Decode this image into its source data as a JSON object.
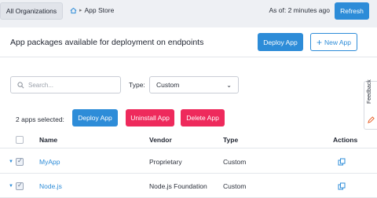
{
  "topbar": {
    "org_button": "All Organizations",
    "breadcrumb": {
      "home_icon": "home-icon",
      "current": "App Store"
    },
    "as_of": "As of: 2 minutes ago",
    "refresh": "Refresh"
  },
  "panel": {
    "title": "App packages available for deployment on endpoints",
    "deploy_button": "Deploy App",
    "new_app_button": "New App"
  },
  "filters": {
    "search_placeholder": "Search...",
    "type_label": "Type:",
    "type_value": "Custom"
  },
  "bulk": {
    "selected_count": "2 apps selected:",
    "deploy": "Deploy App",
    "uninstall": "Uninstall App",
    "delete": "Delete App"
  },
  "table": {
    "headers": {
      "name": "Name",
      "vendor": "Vendor",
      "type": "Type",
      "actions": "Actions"
    },
    "rows": [
      {
        "name": "MyApp",
        "vendor": "Proprietary",
        "type": "Custom",
        "checked": true
      },
      {
        "name": "Node.js",
        "vendor": "Node.js Foundation",
        "type": "Custom",
        "checked": true
      }
    ]
  },
  "feedback": {
    "label": "Feedback"
  },
  "colors": {
    "primary": "#2d8cd8",
    "danger": "#ee2a5c",
    "background": "#eef0f4"
  }
}
